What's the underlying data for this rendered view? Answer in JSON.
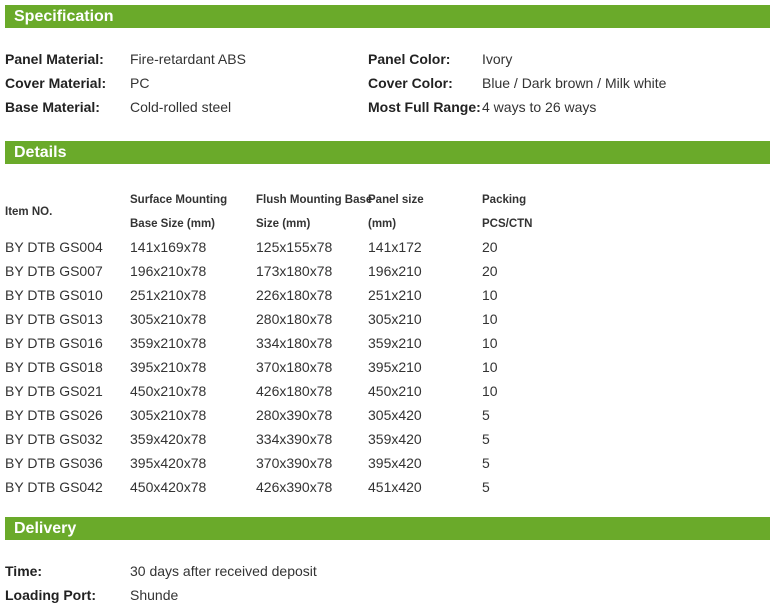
{
  "colors": {
    "accent": "#6aaa2a",
    "text": "#333333"
  },
  "specification": {
    "title": "Specification",
    "left": [
      {
        "label": "Panel Material:",
        "value": "Fire-retardant ABS"
      },
      {
        "label": "Cover Material:",
        "value": "PC"
      },
      {
        "label": "Base Material:",
        "value": "Cold-rolled steel"
      }
    ],
    "right": [
      {
        "label": "Panel Color:",
        "value": "Ivory"
      },
      {
        "label": "Cover Color:",
        "value": "Blue / Dark brown / Milk white"
      },
      {
        "label": "Most Full Range:",
        "value": "4 ways to 26 ways"
      }
    ]
  },
  "details": {
    "title": "Details",
    "headers": {
      "item": "Item NO.",
      "surface_line1": "Surface Mounting",
      "surface_line2": "Base Size (mm)",
      "flush_line1": "Flush Mounting Base",
      "flush_line2": "Size (mm)",
      "panel_line1": "Panel size",
      "panel_line2": "(mm)",
      "packing_line1": "Packing",
      "packing_line2": "PCS/CTN"
    },
    "rows": [
      {
        "item": "BY DTB GS004",
        "surface": "141x169x78",
        "flush": "125x155x78",
        "panel": "141x172",
        "packing": "20"
      },
      {
        "item": "BY DTB GS007",
        "surface": "196x210x78",
        "flush": "173x180x78",
        "panel": "196x210",
        "packing": "20"
      },
      {
        "item": "BY DTB GS010",
        "surface": "251x210x78",
        "flush": "226x180x78",
        "panel": "251x210",
        "packing": "10"
      },
      {
        "item": "BY DTB GS013",
        "surface": "305x210x78",
        "flush": "280x180x78",
        "panel": "305x210",
        "packing": "10"
      },
      {
        "item": "BY DTB GS016",
        "surface": "359x210x78",
        "flush": "334x180x78",
        "panel": "359x210",
        "packing": "10"
      },
      {
        "item": "BY DTB GS018",
        "surface": "395x210x78",
        "flush": "370x180x78",
        "panel": "395x210",
        "packing": "10"
      },
      {
        "item": "BY DTB GS021",
        "surface": "450x210x78",
        "flush": "426x180x78",
        "panel": "450x210",
        "packing": "10"
      },
      {
        "item": "BY DTB GS026",
        "surface": "305x210x78",
        "flush": "280x390x78",
        "panel": "305x420",
        "packing": "5"
      },
      {
        "item": "BY DTB GS032",
        "surface": "359x420x78",
        "flush": "334x390x78",
        "panel": "359x420",
        "packing": "5"
      },
      {
        "item": "BY DTB GS036",
        "surface": "395x420x78",
        "flush": "370x390x78",
        "panel": "395x420",
        "packing": "5"
      },
      {
        "item": "BY DTB GS042",
        "surface": "450x420x78",
        "flush": "426x390x78",
        "panel": "451x420",
        "packing": "5"
      }
    ]
  },
  "delivery": {
    "title": "Delivery",
    "items": [
      {
        "label": "Time:",
        "value": "30 days after received deposit"
      },
      {
        "label": "Loading Port:",
        "value": "Shunde"
      }
    ]
  }
}
